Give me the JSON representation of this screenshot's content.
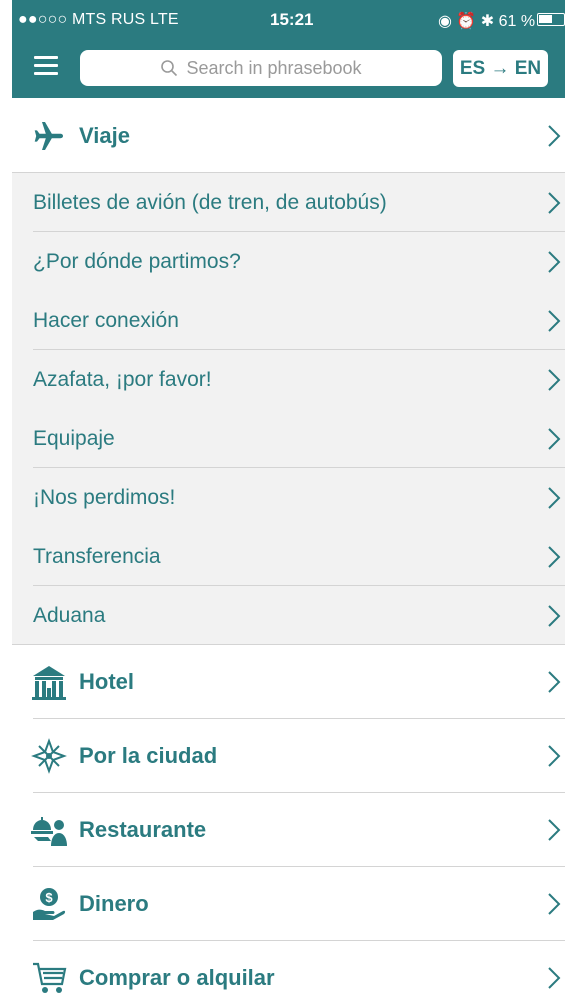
{
  "status": {
    "carrier": "●●○○○ MTS RUS  LTE",
    "time": "15:21",
    "right": "◉ ⏰ ✱ 61 %",
    "battery_percent": 61
  },
  "header": {
    "search_placeholder": "Search in phrasebook",
    "lang_toggle": "ES → EN"
  },
  "colors": {
    "accent": "#2b7b80",
    "sub_bg": "#f2f2f2"
  },
  "categories": [
    {
      "label": "Viaje",
      "icon": "airplane-icon",
      "subitems": [
        "Billetes de avión (de tren, de autobús)",
        "¿Por dónde partimos?",
        "Hacer conexión",
        "Azafata, ¡por favor!",
        "Equipaje",
        "¡Nos perdimos!",
        "Transferencia",
        "Aduana"
      ]
    },
    {
      "label": "Hotel",
      "icon": "hotel-icon"
    },
    {
      "label": "Por la ciudad",
      "icon": "compass-icon"
    },
    {
      "label": "Restaurante",
      "icon": "restaurant-icon"
    },
    {
      "label": "Dinero",
      "icon": "money-icon"
    },
    {
      "label": "Comprar o alquilar",
      "icon": "shopping-cart-icon"
    }
  ]
}
